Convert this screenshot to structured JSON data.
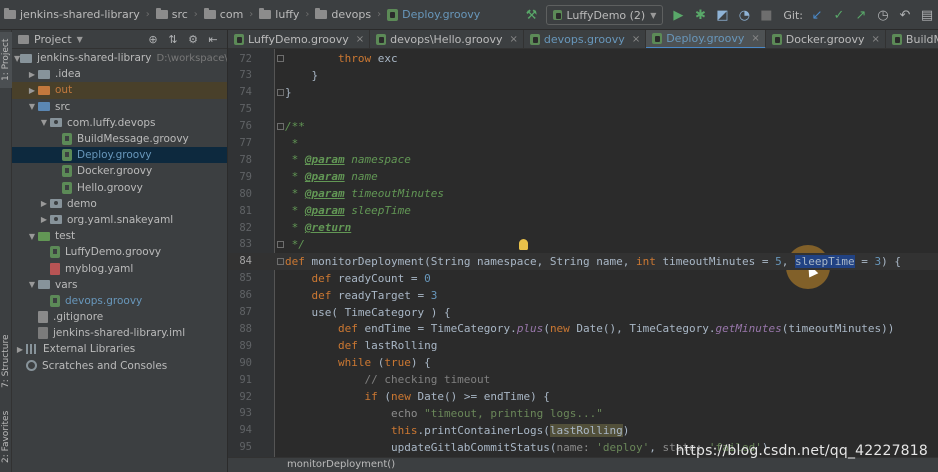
{
  "breadcrumbs": [
    {
      "label": "jenkins-shared-library",
      "icon": "folder-icon"
    },
    {
      "label": "src",
      "icon": "folder-icon"
    },
    {
      "label": "com",
      "icon": "folder-icon"
    },
    {
      "label": "luffy",
      "icon": "folder-icon"
    },
    {
      "label": "devops",
      "icon": "folder-icon"
    },
    {
      "label": "Deploy.groovy",
      "icon": "groovy-file-icon"
    }
  ],
  "toolbar": {
    "run_config": "LuffyDemo (2)",
    "git_label": "Git:"
  },
  "left_strip": {
    "project_tab": "1: Project",
    "structure_tab": "7: Structure",
    "favorites_tab": "2: Favorites"
  },
  "project_panel": {
    "title": "Project",
    "tree": [
      {
        "label": "jenkins-shared-library",
        "hint": "D:\\workspace\\luff",
        "depth": 0,
        "expanded": true,
        "icon": "folder-icon"
      },
      {
        "label": ".idea",
        "depth": 1,
        "expanded": false,
        "icon": "folder-icon"
      },
      {
        "label": "out",
        "depth": 1,
        "expanded": false,
        "icon": "folder-icon"
      },
      {
        "label": "src",
        "depth": 1,
        "expanded": true,
        "icon": "folder-icon"
      },
      {
        "label": "com.luffy.devops",
        "depth": 2,
        "expanded": true,
        "icon": "package-icon"
      },
      {
        "label": "BuildMessage.groovy",
        "depth": 3,
        "icon": "groovy-file-icon"
      },
      {
        "label": "Deploy.groovy",
        "depth": 3,
        "icon": "groovy-file-icon",
        "selected": true
      },
      {
        "label": "Docker.groovy",
        "depth": 3,
        "icon": "groovy-file-icon"
      },
      {
        "label": "Hello.groovy",
        "depth": 3,
        "icon": "groovy-file-icon"
      },
      {
        "label": "demo",
        "depth": 2,
        "expanded": false,
        "icon": "package-icon"
      },
      {
        "label": "org.yaml.snakeyaml",
        "depth": 2,
        "expanded": false,
        "icon": "package-icon"
      },
      {
        "label": "test",
        "depth": 1,
        "expanded": true,
        "icon": "folder-icon"
      },
      {
        "label": "LuffyDemo.groovy",
        "depth": 2,
        "icon": "groovy-file-icon"
      },
      {
        "label": "myblog.yaml",
        "depth": 2,
        "icon": "yaml-file-icon"
      },
      {
        "label": "vars",
        "depth": 1,
        "expanded": true,
        "icon": "folder-icon"
      },
      {
        "label": "devops.groovy",
        "depth": 2,
        "icon": "groovy-file-icon"
      },
      {
        "label": ".gitignore",
        "depth": 1,
        "icon": "gitignore-file-icon"
      },
      {
        "label": "jenkins-shared-library.iml",
        "depth": 1,
        "icon": "iml-file-icon"
      },
      {
        "label": "External Libraries",
        "depth": 0,
        "expanded": false,
        "icon": "library-icon"
      },
      {
        "label": "Scratches and Consoles",
        "depth": 0,
        "icon": "scratch-icon"
      }
    ]
  },
  "tabs": [
    {
      "label": "LuffyDemo.groovy",
      "active": false
    },
    {
      "label": "devops\\Hello.groovy",
      "active": false
    },
    {
      "label": "devops.groovy",
      "active": false
    },
    {
      "label": "Deploy.groovy",
      "active": true
    },
    {
      "label": "Docker.groovy",
      "active": false
    },
    {
      "label": "BuildMessage.groovy",
      "active": false
    }
  ],
  "editor": {
    "current_line": 84,
    "lines": [
      {
        "n": "72",
        "text": "        throw exc"
      },
      {
        "n": "73",
        "text": "    }"
      },
      {
        "n": "74",
        "text": "}"
      },
      {
        "n": "75",
        "text": ""
      },
      {
        "n": "76",
        "text": "/**"
      },
      {
        "n": "77",
        "text": " *"
      },
      {
        "n": "78",
        "text": " * @param namespace"
      },
      {
        "n": "79",
        "text": " * @param name"
      },
      {
        "n": "80",
        "text": " * @param timeoutMinutes"
      },
      {
        "n": "81",
        "text": " * @param sleepTime"
      },
      {
        "n": "82",
        "text": " * @return"
      },
      {
        "n": "83",
        "text": " */"
      },
      {
        "n": "84",
        "text": "def monitorDeployment(String namespace, String name, int timeoutMinutes = 5, sleepTime = 3) {"
      },
      {
        "n": "85",
        "text": "    def readyCount = 0"
      },
      {
        "n": "86",
        "text": "    def readyTarget = 3"
      },
      {
        "n": "87",
        "text": "    use( TimeCategory ) {"
      },
      {
        "n": "88",
        "text": "        def endTime = TimeCategory.plus(new Date(), TimeCategory.getMinutes(timeoutMinutes))"
      },
      {
        "n": "89",
        "text": "        def lastRolling"
      },
      {
        "n": "90",
        "text": "        while (true) {"
      },
      {
        "n": "91",
        "text": "            // checking timeout"
      },
      {
        "n": "92",
        "text": "            if (new Date() >= endTime) {"
      },
      {
        "n": "93",
        "text": "                echo \"timeout, printing logs...\""
      },
      {
        "n": "94",
        "text": "                this.printContainerLogs(lastRolling)"
      },
      {
        "n": "95",
        "text": "                updateGitlabCommitStatus(name: 'deploy', state: 'failed')"
      }
    ]
  },
  "bottom": {
    "breadcrumb": "monitorDeployment()"
  },
  "watermark": "https://blog.csdn.net/qq_42227818"
}
